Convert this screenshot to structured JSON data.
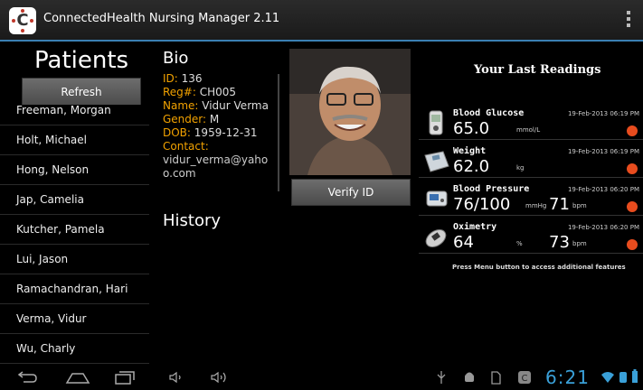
{
  "app": {
    "icon_letter": "C",
    "title": "ConnectedHealth Nursing Manager 2.11"
  },
  "patients": {
    "title": "Patients",
    "refresh_label": "Refresh",
    "items": [
      "Freeman, Morgan",
      "Holt, Michael",
      "Hong, Nelson",
      "Jap, Camelia",
      "Kutcher, Pamela",
      "Lui, Jason",
      "Ramachandran, Hari",
      "Verma, Vidur",
      "Wu, Charly"
    ]
  },
  "bio": {
    "title": "Bio",
    "id_label": "ID:",
    "id_value": "136",
    "reg_label": "Reg#:",
    "reg_value": "CH005",
    "name_label": "Name:",
    "name_value": "Vidur Verma",
    "gender_label": "Gender:",
    "gender_value": "M",
    "dob_label": "DOB:",
    "dob_value": "1959-12-31",
    "contact_label": "Contact:",
    "contact_value": "vidur_verma@yahoo.com"
  },
  "verify_label": "Verify ID",
  "history_title": "History",
  "readings": {
    "title": "Your Last Readings",
    "items": [
      {
        "label": "Blood Glucose",
        "date": "19-Feb-2013 06:19 PM",
        "value": "65.0",
        "unit": "mmol/L",
        "icon": "glucometer-icon"
      },
      {
        "label": "Weight",
        "date": "19-Feb-2013 06:19 PM",
        "value": "62.0",
        "unit": "kg",
        "icon": "scale-icon"
      },
      {
        "label": "Blood Pressure",
        "date": "19-Feb-2013 06:20 PM",
        "value": "76/100",
        "unit": "mmHg",
        "value2": "71",
        "unit2": "bpm",
        "icon": "bp-monitor-icon"
      },
      {
        "label": "Oximetry",
        "date": "19-Feb-2013 06:20 PM",
        "value": "64",
        "unit": "%",
        "value2": "73",
        "unit2": "bpm",
        "icon": "oximeter-icon"
      }
    ],
    "note": "Press Menu button to access additional features"
  },
  "status": {
    "time": "6:21"
  },
  "colors": {
    "accent": "#3b7fb3",
    "label_orange": "#f2a200",
    "status_dot": "#e84c1e",
    "clock_blue": "#3aa0d8"
  }
}
